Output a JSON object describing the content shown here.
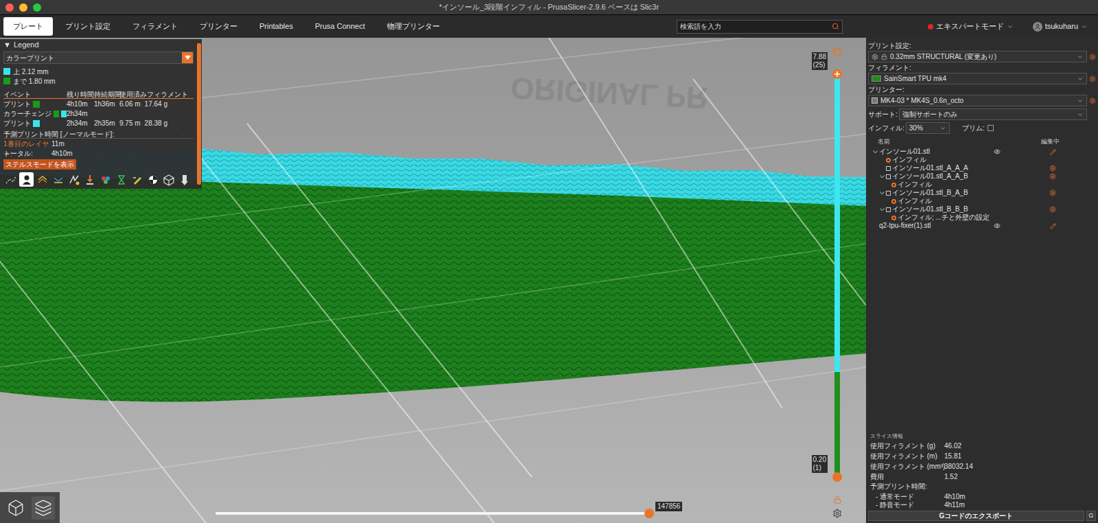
{
  "window": {
    "title": "*インソール_3段階インフィル - PrusaSlicer-2.9.6 ベースは Slic3r"
  },
  "tabs": [
    {
      "label": "プレート",
      "selected": true
    },
    {
      "label": "プリント設定",
      "selected": false
    },
    {
      "label": "フィラメント",
      "selected": false
    },
    {
      "label": "プリンター",
      "selected": false
    },
    {
      "label": "Printables",
      "selected": false
    },
    {
      "label": "Prusa Connect",
      "selected": false
    },
    {
      "label": "物理プリンター",
      "selected": false
    }
  ],
  "search": {
    "placeholder": "検索語を入力"
  },
  "mode": {
    "label": "エキスパートモード",
    "color": "#e0242b"
  },
  "user": {
    "name": "tsukuharu"
  },
  "legend": {
    "toggle": "▼",
    "title": "Legend",
    "view_type": "カラープリント",
    "ranges": [
      {
        "label": "上 2.12 mm",
        "color": "#39e3ee"
      },
      {
        "label": "まで 1.80 mm",
        "color": "#1a9a1a"
      }
    ],
    "columns": [
      "イベント",
      "残り時間",
      "持続期間",
      "使用済みフィラメント"
    ],
    "events": [
      {
        "event": "プリント",
        "colors": [
          "#1a9a1a"
        ],
        "remaining": "4h10m",
        "duration": "1h36m",
        "length": "6.06 m",
        "weight": "17.64 g"
      },
      {
        "event": "カラーチェンジ",
        "colors": [
          "#1a9a1a",
          "#39e3ee"
        ],
        "remaining": "2h34m",
        "duration": "",
        "length": "",
        "weight": ""
      },
      {
        "event": "プリント",
        "colors": [
          "#39e3ee"
        ],
        "remaining": "2h34m",
        "duration": "2h35m",
        "length": "9.75 m",
        "weight": "28.38 g"
      }
    ],
    "estimate_title": "予測プリント時間 [ノーマルモード]:",
    "estimates": [
      {
        "label": "1番目のレイヤー:",
        "value": "11m",
        "color": "#e8742c"
      },
      {
        "label": "トータル:",
        "value": "4h10m",
        "color": "#e0e0e0"
      }
    ],
    "stealth_button": "ステルスモードを表示",
    "toolbar": [
      {
        "selected": false
      },
      {
        "selected": true
      },
      {
        "selected": false
      },
      {
        "selected": false
      },
      {
        "selected": false
      },
      {
        "selected": false
      },
      {
        "selected": false
      },
      {
        "selected": false
      },
      {
        "selected": false
      },
      {
        "selected": false
      },
      {
        "selected": false
      },
      {
        "selected": false
      }
    ]
  },
  "layer_slider": {
    "upper": {
      "height": "7.88",
      "layer": "(25)"
    },
    "lower": {
      "height": "0.20",
      "layer": "(1)"
    },
    "upper_level": 1,
    "lower_level": 0,
    "segments": [
      {
        "color": "#1f8f1f",
        "share": 0.26
      },
      {
        "color": "#3de6f0",
        "share": 0.74
      }
    ]
  },
  "move_slider": {
    "value": "147856",
    "level": 1
  },
  "view_buttons": [
    {
      "selected": false
    },
    {
      "selected": true
    }
  ],
  "bed": {
    "logo": "ORIGINAL PR"
  },
  "sidebar": {
    "presets": [
      {
        "label": "プリント設定:",
        "value": "0.32mm STRUCTURAL (変更あり)",
        "kind": "print",
        "color": "#777777"
      },
      {
        "label": "フィラメント:",
        "value": "SainSmart TPU mk4",
        "kind": "filament",
        "color": "#1e8c1e"
      },
      {
        "label": "プリンター:",
        "value": "MK4-03 * MK4S_0.6n_octo",
        "kind": "printer",
        "color": "#777777"
      }
    ],
    "support": {
      "label": "サポート:",
      "value": "強制サポートのみ"
    },
    "infill": {
      "label": "インフィル:",
      "value": "30%"
    },
    "brim": {
      "label": "ブリム:",
      "checked": false
    },
    "object_list": {
      "columns": [
        "名前",
        "編集中"
      ],
      "items": [
        {
          "name": "インソール01.stl",
          "kind": "object",
          "level": 0,
          "expanded": true
        },
        {
          "name": "インフィル",
          "kind": "settings",
          "level": 1,
          "expanded": false
        },
        {
          "name": "インソール01.stl_A_A_A",
          "kind": "part",
          "level": 1,
          "expanded": false
        },
        {
          "name": "インソール01.stl_A_A_B",
          "kind": "part",
          "level": 1,
          "expanded": true
        },
        {
          "name": "インフィル",
          "kind": "settings",
          "level": 2,
          "expanded": false
        },
        {
          "name": "インソール01.stl_B_A_B",
          "kind": "part",
          "level": 1,
          "expanded": true
        },
        {
          "name": "インフィル",
          "kind": "settings",
          "level": 2,
          "expanded": false
        },
        {
          "name": "インソール01.stl_B_B_B",
          "kind": "part",
          "level": 1,
          "expanded": true
        },
        {
          "name": "インフィル; ...チと外壁の設定",
          "kind": "settings",
          "level": 2,
          "expanded": false
        },
        {
          "name": "q2-tpu-fixer(1).stl",
          "kind": "object",
          "level": 0,
          "expanded": false
        }
      ]
    },
    "slice_info": {
      "title": "スライス情報",
      "rows": [
        {
          "label": "使用フィラメント (g)",
          "value": "46.02"
        },
        {
          "label": "使用フィラメント (m)",
          "value": "15.81"
        },
        {
          "label": "使用フィラメント (mm³)",
          "value": "38032.14"
        },
        {
          "label": "費用",
          "value": "1.52"
        }
      ],
      "time_title": "予測プリント時間:",
      "times": [
        {
          "label": "- 通常モード",
          "value": "4h10m"
        },
        {
          "label": "- 静音モード",
          "value": "4h11m"
        }
      ]
    },
    "export": {
      "label": "Gコードのエクスポート",
      "send": "G"
    }
  }
}
